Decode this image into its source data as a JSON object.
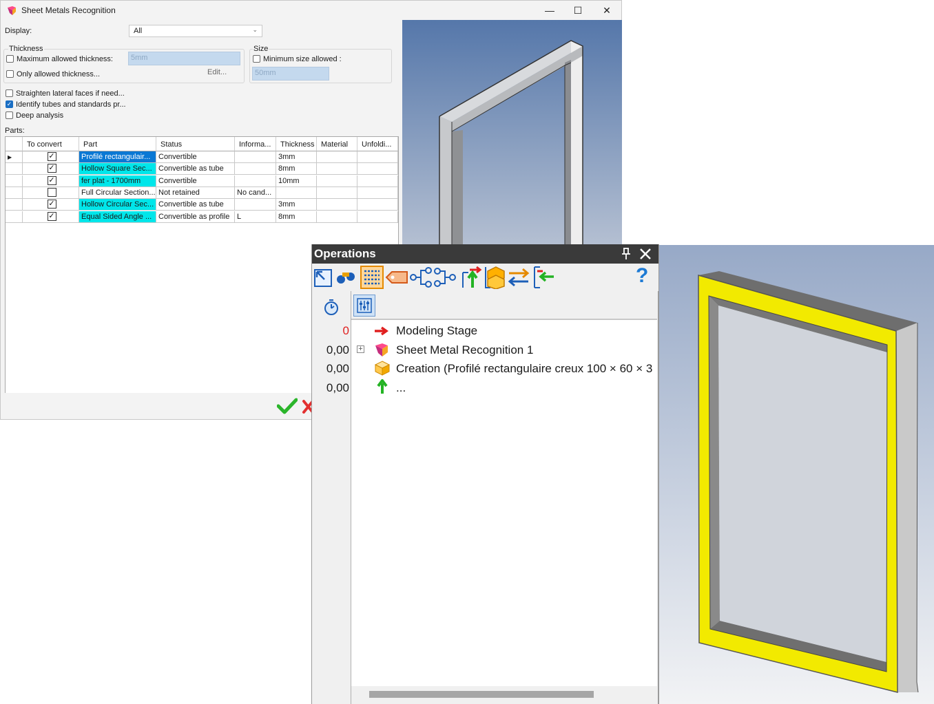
{
  "dialog": {
    "title": "Sheet Metals Recognition",
    "display_label": "Display:",
    "display_value": "All",
    "thickness": {
      "group_label": "Thickness",
      "max_allowed_label": "Maximum allowed thickness:",
      "max_allowed_checked": false,
      "max_allowed_value": "5mm",
      "only_allowed_label": "Only allowed thickness...",
      "only_allowed_checked": false,
      "edit_label": "Edit..."
    },
    "size": {
      "group_label": "Size",
      "min_size_label": "Minimum size allowed :",
      "min_size_checked": false,
      "min_size_value": "50mm"
    },
    "options": [
      {
        "label": "Straighten lateral faces if need...",
        "checked": false
      },
      {
        "label": "Identify tubes and standards pr...",
        "checked": true
      },
      {
        "label": "Deep analysis",
        "checked": false
      }
    ],
    "parts_label": "Parts:",
    "columns": [
      "To convert",
      "Part",
      "Status",
      "Informa...",
      "Thickness",
      "Material",
      "Unfoldi..."
    ],
    "rows": [
      {
        "current": true,
        "to_convert": true,
        "part": "Profilé rectangulair...",
        "highlight": "selected",
        "status": "Convertible",
        "info": "",
        "thickness": "3mm"
      },
      {
        "current": false,
        "to_convert": true,
        "part": "Hollow Square Sec...",
        "highlight": "cyan",
        "status": "Convertible as tube",
        "info": "",
        "thickness": "8mm"
      },
      {
        "current": false,
        "to_convert": true,
        "part": "fer plat - 1700mm",
        "highlight": "cyan",
        "status": "Convertible",
        "info": "",
        "thickness": "10mm"
      },
      {
        "current": false,
        "to_convert": false,
        "part": "Full Circular Section...",
        "highlight": "none",
        "status": "Not retained",
        "info": "No cand...",
        "thickness": ""
      },
      {
        "current": false,
        "to_convert": true,
        "part": "Hollow Circular Sec...",
        "highlight": "cyan",
        "status": "Convertible as tube",
        "info": "",
        "thickness": "3mm"
      },
      {
        "current": false,
        "to_convert": true,
        "part": "Equal Sided Angle ...",
        "highlight": "cyan",
        "status": "Convertible as profile",
        "info": "L",
        "thickness": "8mm"
      }
    ],
    "window_buttons": {
      "minimize": "—",
      "maximize": "☐",
      "close": "✕"
    },
    "ok_icon": "checkmark-icon",
    "cancel_icon": "cancel-icon"
  },
  "operations": {
    "title": "Operations",
    "pin_icon": "pin-icon",
    "close_icon": "close-icon",
    "toolbar_icons": [
      "select-icon",
      "binoculars-icon",
      "list-icon",
      "tag-icon",
      "tree-icon",
      "tree-link-icon",
      "move-up-icon",
      "stack-icon",
      "swap-icon",
      "insert-icon"
    ],
    "help_label": "?",
    "tabs": [
      "timer-icon",
      "settings-icon"
    ],
    "tree": [
      {
        "value": "0",
        "label": "Modeling Stage",
        "icon": "arrow-right-icon"
      },
      {
        "value": "0,00",
        "label": "Sheet Metal Recognition 1",
        "icon": "sheet-metal-icon",
        "expandable": true
      },
      {
        "value": "0,00",
        "label": "Creation (Profilé rectangulaire creux 100 × 60 × 3",
        "icon": "box-icon"
      },
      {
        "value": "0,00",
        "label": "...",
        "icon": "arrow-up-icon"
      }
    ],
    "expand_symbol": "+"
  },
  "colors": {
    "selected": "#0a78d4",
    "highlight": "#00e6ea",
    "ok": "#2bb52b",
    "cancel": "#e23030",
    "panel_title": "#3a3a3a",
    "frame_yellow": "#f2ea00"
  }
}
